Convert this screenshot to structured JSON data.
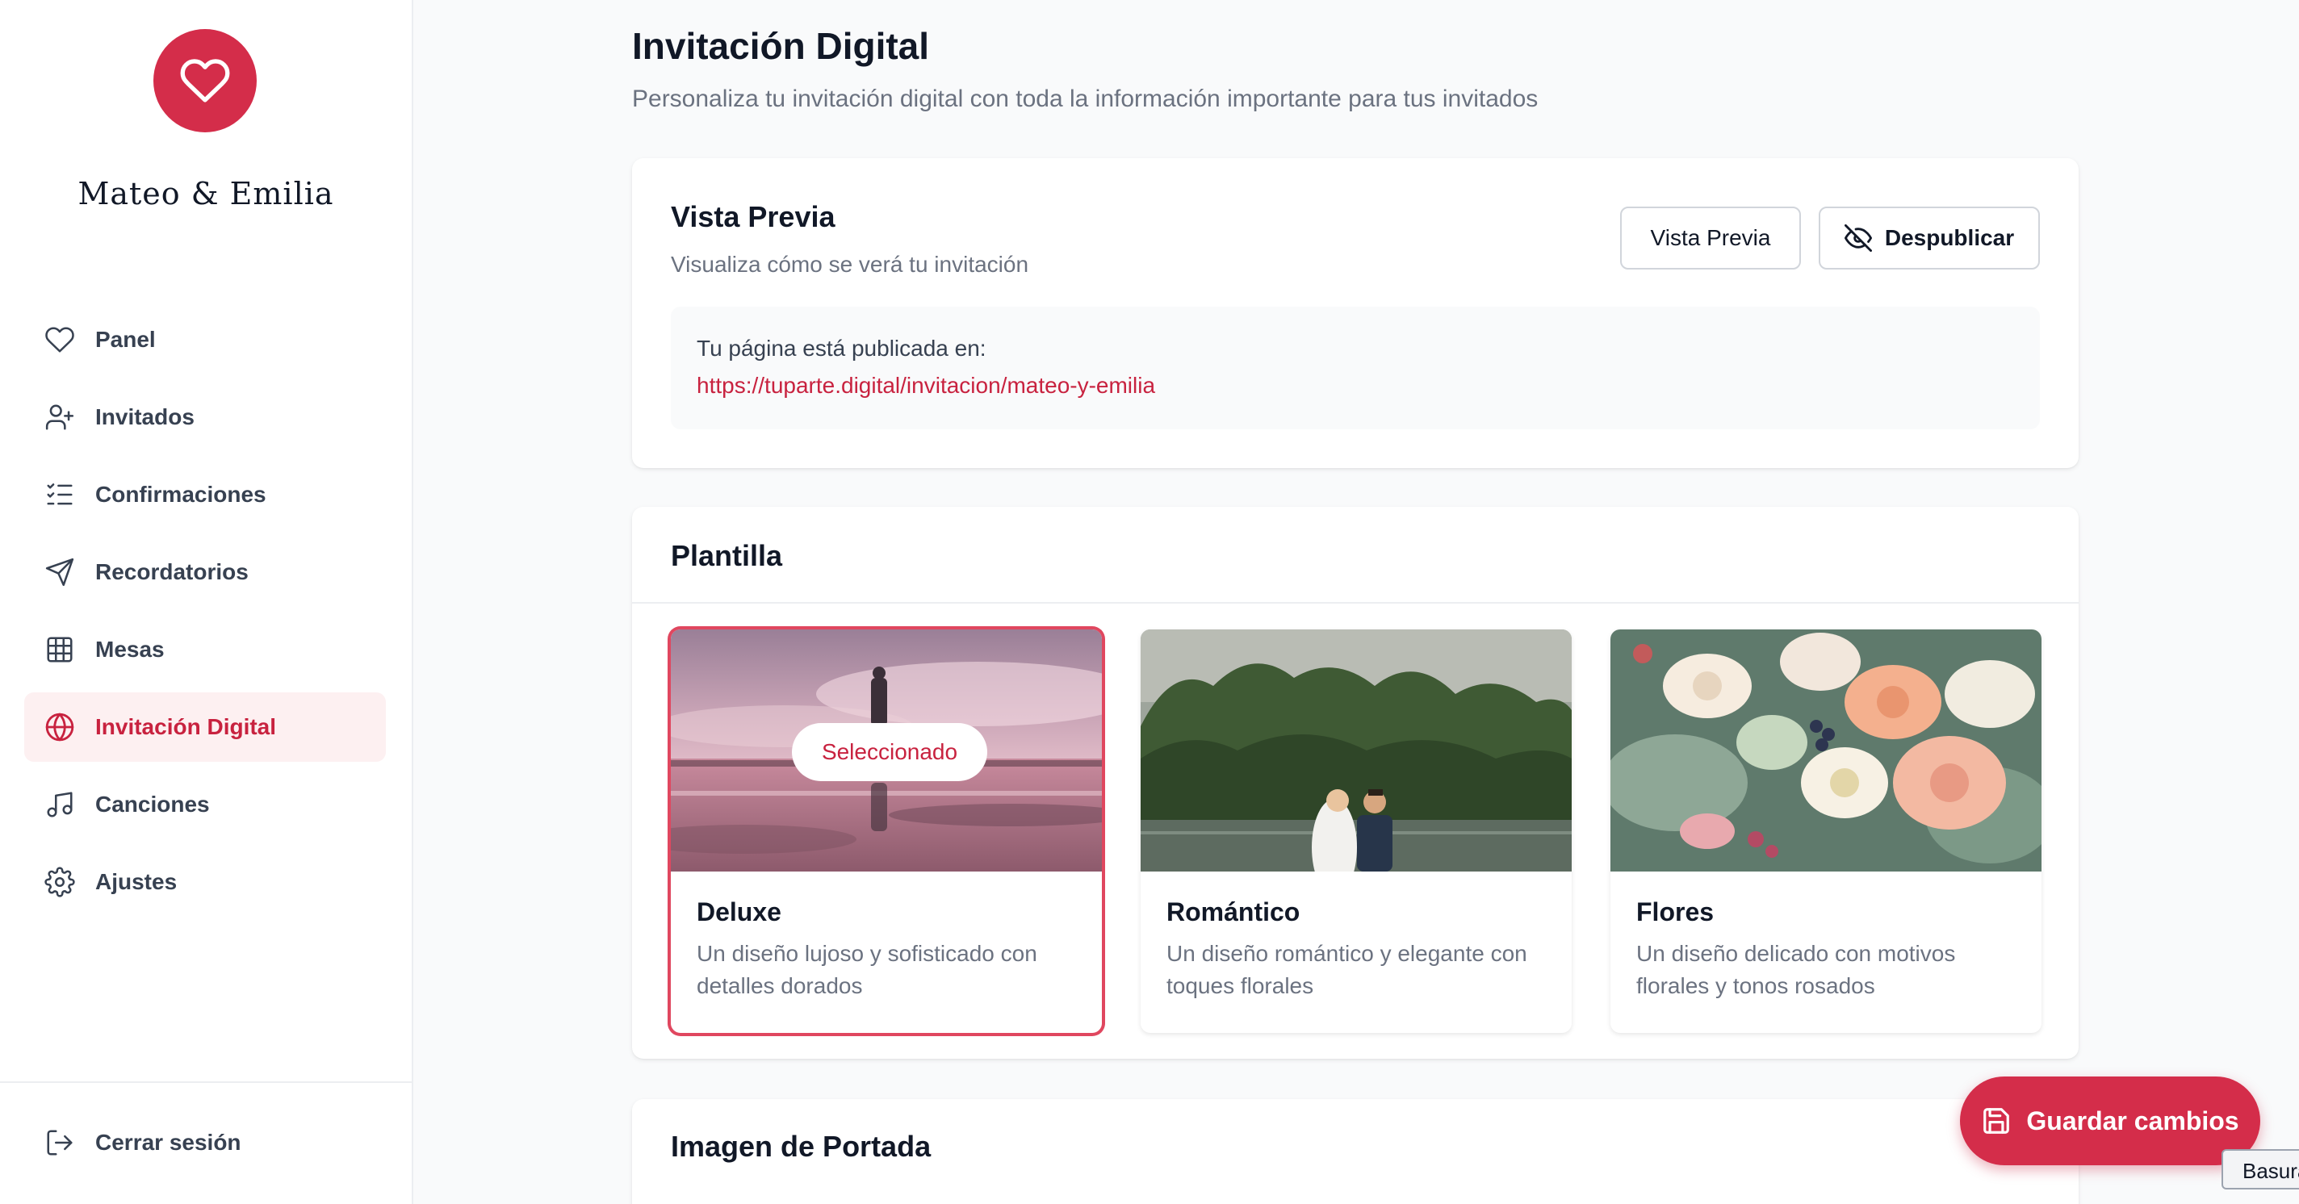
{
  "sidebar": {
    "couple_name": "Mateo & Emilia",
    "items": [
      {
        "label": "Panel",
        "icon": "heart-icon"
      },
      {
        "label": "Invitados",
        "icon": "user-plus-icon"
      },
      {
        "label": "Confirmaciones",
        "icon": "list-check-icon"
      },
      {
        "label": "Recordatorios",
        "icon": "send-icon"
      },
      {
        "label": "Mesas",
        "icon": "grid-icon"
      },
      {
        "label": "Invitación Digital",
        "icon": "globe-icon",
        "active": true
      },
      {
        "label": "Canciones",
        "icon": "music-icon"
      },
      {
        "label": "Ajustes",
        "icon": "gear-icon"
      }
    ],
    "logout_label": "Cerrar sesión"
  },
  "header": {
    "title": "Invitación Digital",
    "subtitle": "Personaliza tu invitación digital con toda la información importante para tus invitados"
  },
  "preview": {
    "title": "Vista Previa",
    "subtitle": "Visualiza cómo se verá tu invitación",
    "preview_button": "Vista Previa",
    "unpublish_button": "Despublicar",
    "published_label": "Tu página está publicada en:",
    "published_url": "https://tuparte.digital/invitacion/mateo-y-emilia"
  },
  "templates": {
    "title": "Plantilla",
    "selected_label": "Seleccionado",
    "items": [
      {
        "name": "Deluxe",
        "description": "Un diseño lujoso y sofisticado con detalles dorados",
        "selected": true
      },
      {
        "name": "Romántico",
        "description": "Un diseño romántico y elegante con toques florales",
        "selected": false
      },
      {
        "name": "Flores",
        "description": "Un diseño delicado con motivos florales y tonos rosados",
        "selected": false
      }
    ]
  },
  "cover": {
    "title": "Imagen de Portada"
  },
  "actions": {
    "save_label": "Guardar cambios"
  },
  "tooltip": {
    "text": "Basura"
  },
  "colors": {
    "accent": "#d42d4a",
    "accent_text": "#c8223f",
    "active_bg": "#fdf0f1"
  }
}
